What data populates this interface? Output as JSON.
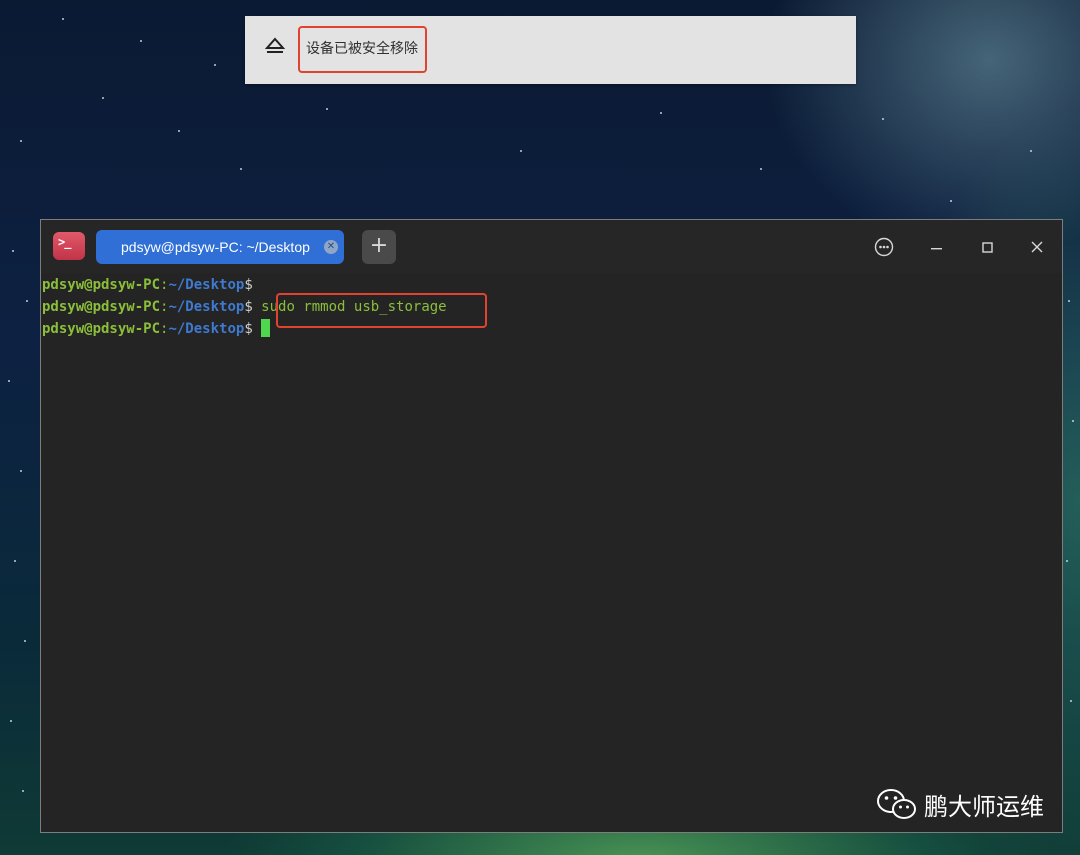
{
  "notification": {
    "message": "设备已被安全移除",
    "icon": "eject-icon"
  },
  "terminal": {
    "tab_title": "pdsyw@pdsyw-PC: ~/Desktop",
    "new_tab_label": "+",
    "lines": [
      {
        "user": "pdsyw@pdsyw-PC",
        "path": "~/Desktop",
        "command": ""
      },
      {
        "user": "pdsyw@pdsyw-PC",
        "path": "~/Desktop",
        "command": "sudo rmmod usb_storage"
      },
      {
        "user": "pdsyw@pdsyw-PC",
        "path": "~/Desktop",
        "command": ""
      }
    ],
    "colors": {
      "prompt_user": "#8bbf3a",
      "prompt_path": "#3f7ad0",
      "cursor": "#4fd84f",
      "tab_active": "#2f6fd6",
      "highlight": "#e0442e"
    }
  },
  "watermark": {
    "text": "鹏大师运维"
  }
}
